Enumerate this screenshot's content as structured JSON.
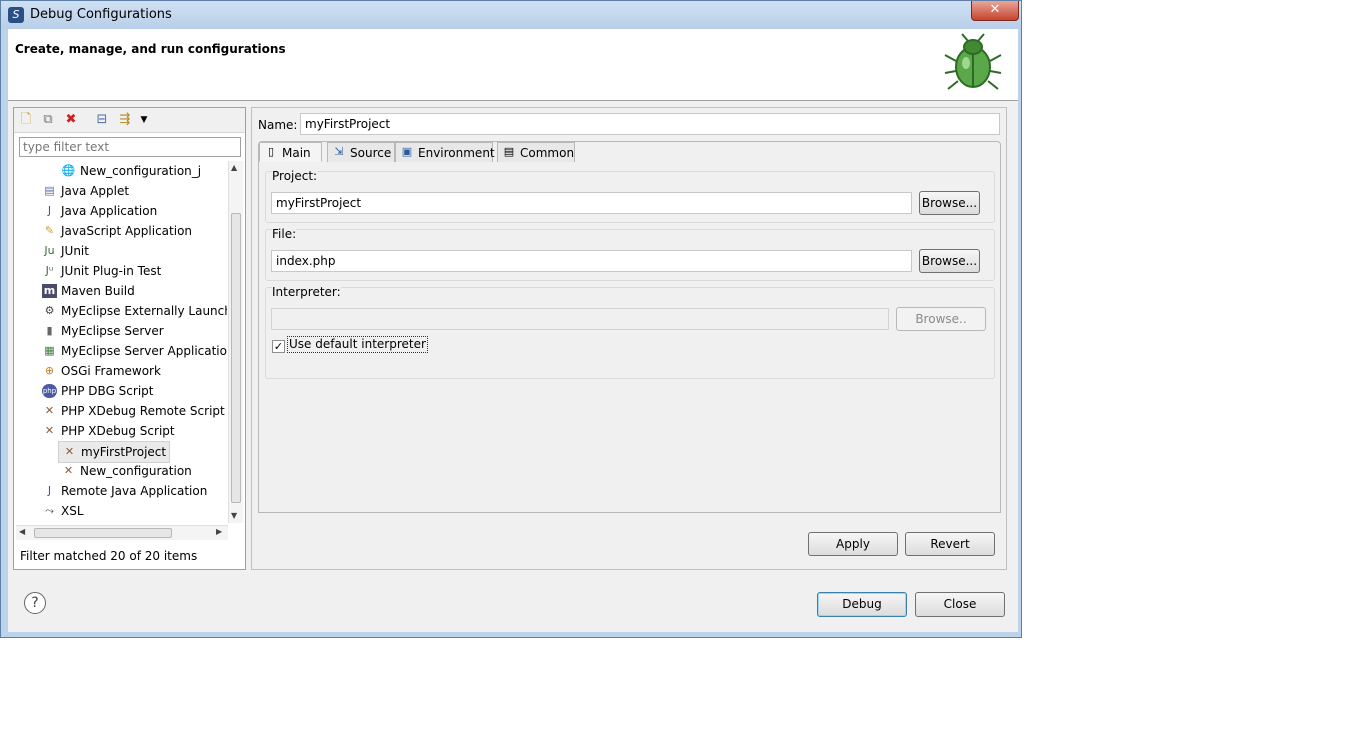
{
  "window": {
    "title": "Debug Configurations",
    "close_label": "✕"
  },
  "header": {
    "title": "Create, manage, and run configurations"
  },
  "left": {
    "filter_placeholder": "type filter text",
    "items": [
      {
        "label": "New_configuration_j",
        "icon": "globe-icon",
        "indent": 2
      },
      {
        "label": "Java Applet",
        "icon": "java-applet-icon",
        "indent": 1
      },
      {
        "label": "Java Application",
        "icon": "java-application-icon",
        "indent": 1
      },
      {
        "label": "JavaScript Application",
        "icon": "javascript-icon",
        "indent": 1
      },
      {
        "label": "JUnit",
        "icon": "junit-icon",
        "indent": 1
      },
      {
        "label": "JUnit Plug-in Test",
        "icon": "junit-plugin-icon",
        "indent": 1
      },
      {
        "label": "Maven Build",
        "icon": "maven-icon",
        "indent": 1
      },
      {
        "label": "MyEclipse Externally Launch",
        "icon": "external-launch-icon",
        "indent": 1
      },
      {
        "label": "MyEclipse Server",
        "icon": "server-icon",
        "indent": 1
      },
      {
        "label": "MyEclipse Server Applicatio",
        "icon": "server-app-icon",
        "indent": 1
      },
      {
        "label": "OSGi Framework",
        "icon": "osgi-icon",
        "indent": 1
      },
      {
        "label": "PHP DBG Script",
        "icon": "php-icon",
        "indent": 1
      },
      {
        "label": "PHP XDebug Remote Script",
        "icon": "xdebug-icon",
        "indent": 1
      },
      {
        "label": "PHP XDebug Script",
        "icon": "xdebug-icon",
        "indent": 1
      },
      {
        "label": "myFirstProject",
        "icon": "xdebug-icon",
        "indent": 2,
        "selected": true
      },
      {
        "label": "New_configuration",
        "icon": "xdebug-icon",
        "indent": 2
      },
      {
        "label": "Remote Java Application",
        "icon": "remote-java-icon",
        "indent": 1
      },
      {
        "label": "XSL",
        "icon": "xsl-icon",
        "indent": 1
      }
    ],
    "status": "Filter matched 20 of 20 items"
  },
  "main": {
    "name_label": "Name:",
    "name_value": "myFirstProject",
    "tabs": [
      {
        "label": "Main",
        "icon": "main-tab-icon"
      },
      {
        "label": "Source",
        "icon": "source-tab-icon"
      },
      {
        "label": "Environment",
        "icon": "environment-tab-icon"
      },
      {
        "label": "Common",
        "icon": "common-tab-icon"
      }
    ],
    "project_label": "Project:",
    "project_value": "myFirstProject",
    "file_label": "File:",
    "file_value": "index.php",
    "interpreter_label": "Interpreter:",
    "interpreter_value": "",
    "browse_label": "Browse...",
    "browse_disabled_label": "Browse..",
    "use_default_label": "Use default interpreter",
    "use_default_checked": true,
    "apply_label": "Apply",
    "revert_label": "Revert"
  },
  "footer": {
    "debug_label": "Debug",
    "close_label": "Close",
    "help_label": "?"
  }
}
